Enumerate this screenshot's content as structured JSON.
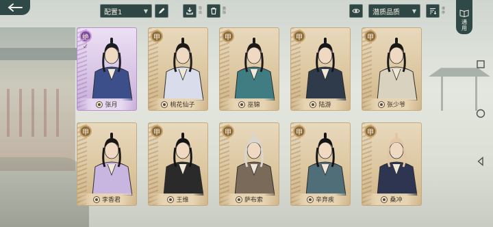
{
  "toolbar": {
    "preset_label": "配置1",
    "edit_label": "",
    "export_label": "导出",
    "delete_label": "删除",
    "sort_label": "潜质品质",
    "filter_label": "排序"
  },
  "side_tab": {
    "label": "通用"
  },
  "cards": [
    {
      "name": "张月",
      "grade": "绝",
      "selected": true
    },
    {
      "name": "桃花仙子",
      "grade": "甲"
    },
    {
      "name": "巫锦",
      "grade": "甲"
    },
    {
      "name": "陆游",
      "grade": "甲"
    },
    {
      "name": "张少爷",
      "grade": "甲"
    },
    {
      "name": "李香君",
      "grade": "甲"
    },
    {
      "name": "王维",
      "grade": "甲"
    },
    {
      "name": "萨布索",
      "grade": "甲"
    },
    {
      "name": "辛弃疾",
      "grade": "甲"
    },
    {
      "name": "桑冲",
      "grade": "甲"
    }
  ],
  "colors": {
    "accent_dark_teal": "#2f4a46",
    "card_gold": "#dcc7a0",
    "card_selected_purple": "#d7c3e6"
  }
}
